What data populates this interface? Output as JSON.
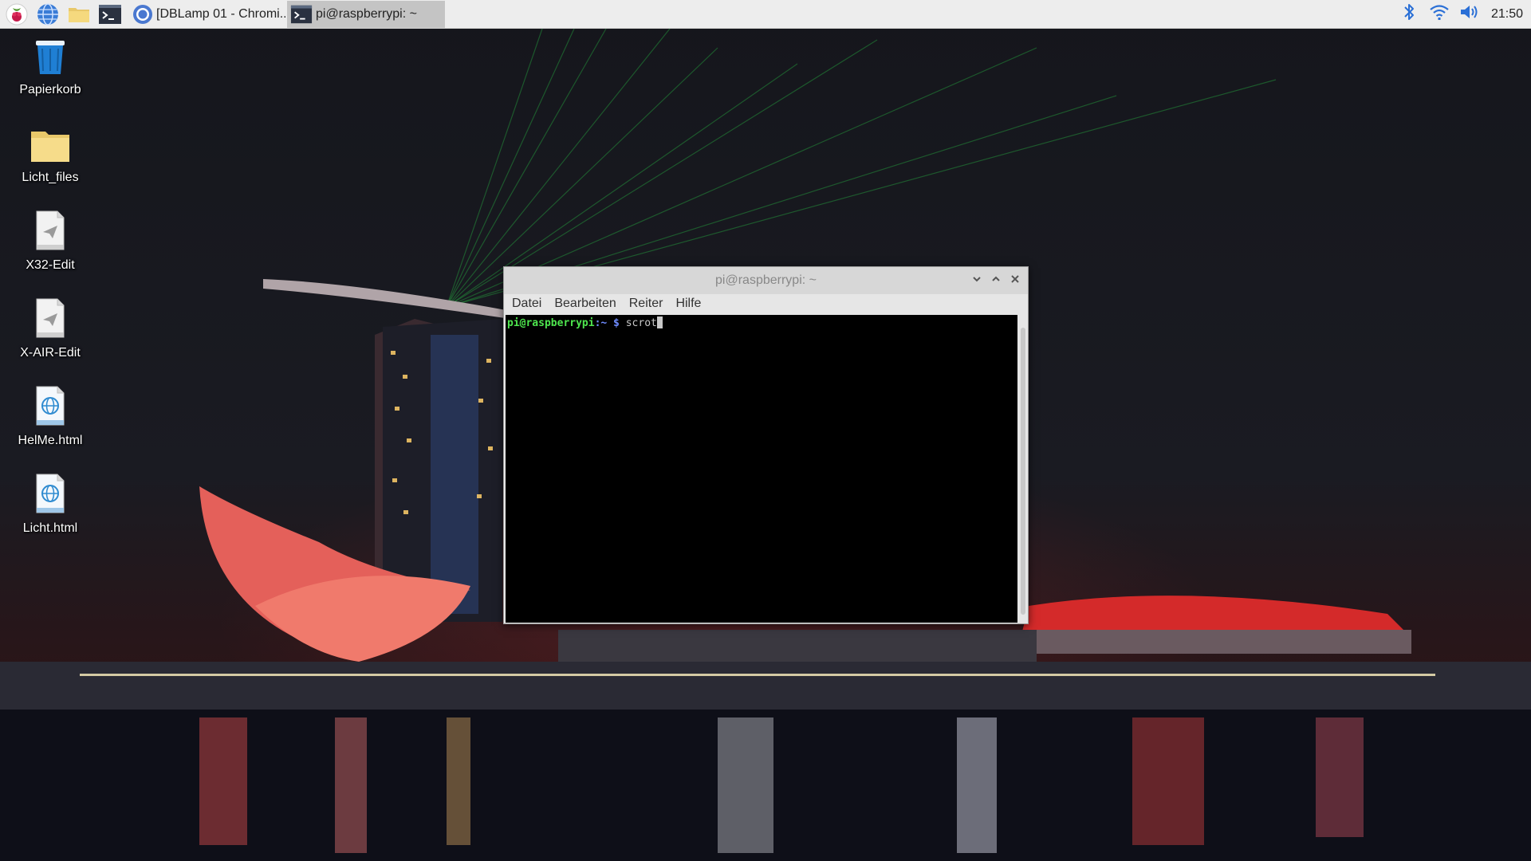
{
  "taskbar": {
    "launchers": [
      {
        "icon": "raspberry-menu-icon"
      },
      {
        "icon": "globe-browser-icon"
      },
      {
        "icon": "file-manager-folder-icon"
      },
      {
        "icon": "terminal-icon"
      }
    ],
    "tasks": [
      {
        "label": "[DBLamp 01 - Chromi...",
        "icon": "chromium-icon",
        "active": false
      },
      {
        "label": "pi@raspberrypi: ~",
        "icon": "terminal-icon",
        "active": true
      }
    ],
    "tray": {
      "icons": [
        "bluetooth-icon",
        "wifi-icon",
        "volume-icon"
      ],
      "clock": "21:50"
    },
    "colors": {
      "background": "#ededed",
      "active_task": "#c4c4c4"
    }
  },
  "desktop": {
    "icons": [
      {
        "label": "Papierkorb",
        "icon": "trash-icon"
      },
      {
        "label": "Licht_files",
        "icon": "folder-icon"
      },
      {
        "label": "X32-Edit",
        "icon": "app-file-icon"
      },
      {
        "label": "X-AIR-Edit",
        "icon": "app-file-icon"
      },
      {
        "label": "HelMe.html",
        "icon": "html-file-icon"
      },
      {
        "label": "Licht.html",
        "icon": "html-file-icon"
      }
    ]
  },
  "terminal": {
    "title": "pi@raspberrypi: ~",
    "menu": [
      "Datei",
      "Bearbeiten",
      "Reiter",
      "Hilfe"
    ],
    "prompt_user": "pi@raspberrypi",
    "prompt_path": ":~ $",
    "command": "scrot",
    "colors": {
      "user": "#4ee64e",
      "path": "#6f8cff",
      "background": "#000000"
    }
  }
}
